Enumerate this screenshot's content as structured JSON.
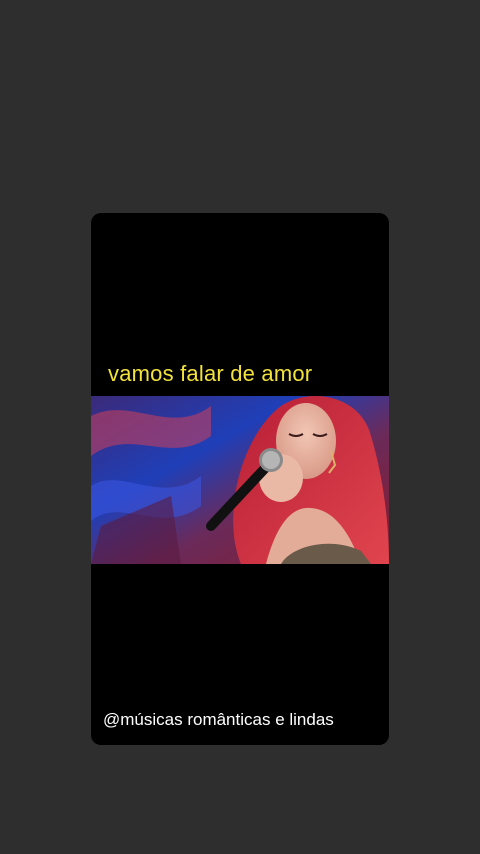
{
  "story": {
    "caption": "vamos falar de amor",
    "watermark": "@músicas românticas e lindas",
    "caption_color": "#f2e23a",
    "watermark_color": "#ffffff",
    "background_color": "#2f2e2e",
    "card_color": "#000000"
  },
  "video": {
    "subject": "singer-with-microphone",
    "hair_color": "#c8283a",
    "background_accent": "#2a3fbf"
  }
}
